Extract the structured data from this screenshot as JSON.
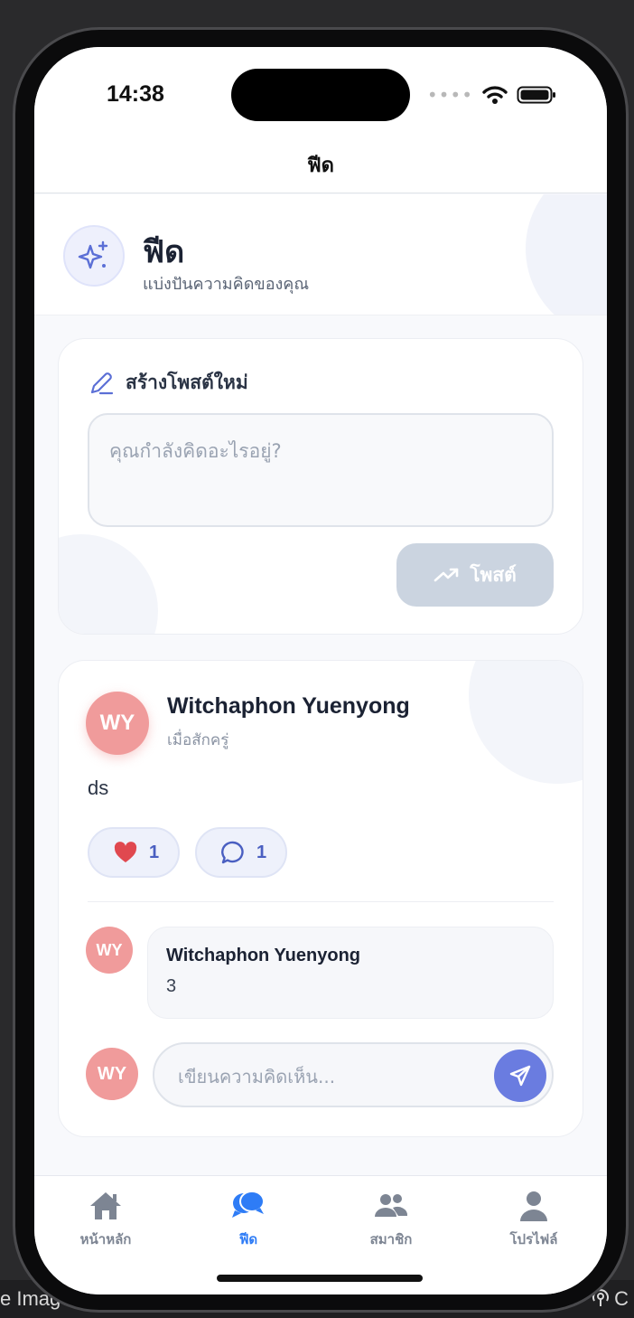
{
  "status_bar": {
    "time": "14:38"
  },
  "nav": {
    "title": "ฟีด"
  },
  "header": {
    "title": "ฟีด",
    "subtitle": "แบ่งปันความคิดของคุณ",
    "icon": "sparkles-icon"
  },
  "compose": {
    "title": "สร้างโพสต์ใหม่",
    "placeholder": "คุณกำลังคิดอะไรอยู่?",
    "post_label": "โพสต์"
  },
  "post": {
    "avatar_initials": "WY",
    "author": "Witchaphon Yuenyong",
    "time_ago": "เมื่อสักครู่",
    "text": "ds",
    "like_count": "1",
    "comment_count": "1",
    "comments": [
      {
        "initials": "WY",
        "author": "Witchaphon Yuenyong",
        "text": "3"
      }
    ],
    "comment_input_initials": "WY",
    "comment_placeholder": "เขียนความคิดเห็น..."
  },
  "tabs": [
    {
      "label": "หน้าหลัก",
      "icon": "home-icon"
    },
    {
      "label": "ฟีด",
      "icon": "chat-bubbles-icon",
      "active": true
    },
    {
      "label": "สมาชิก",
      "icon": "users-icon"
    },
    {
      "label": "โปรไฟล์",
      "icon": "user-icon"
    }
  ],
  "desktop": {
    "left_label": "e Image",
    "right_label": "C"
  },
  "colors": {
    "accent": "#2e7cf6",
    "avatar": "#f09b9b",
    "send": "#6a7ce0",
    "like": "#e0484f"
  }
}
